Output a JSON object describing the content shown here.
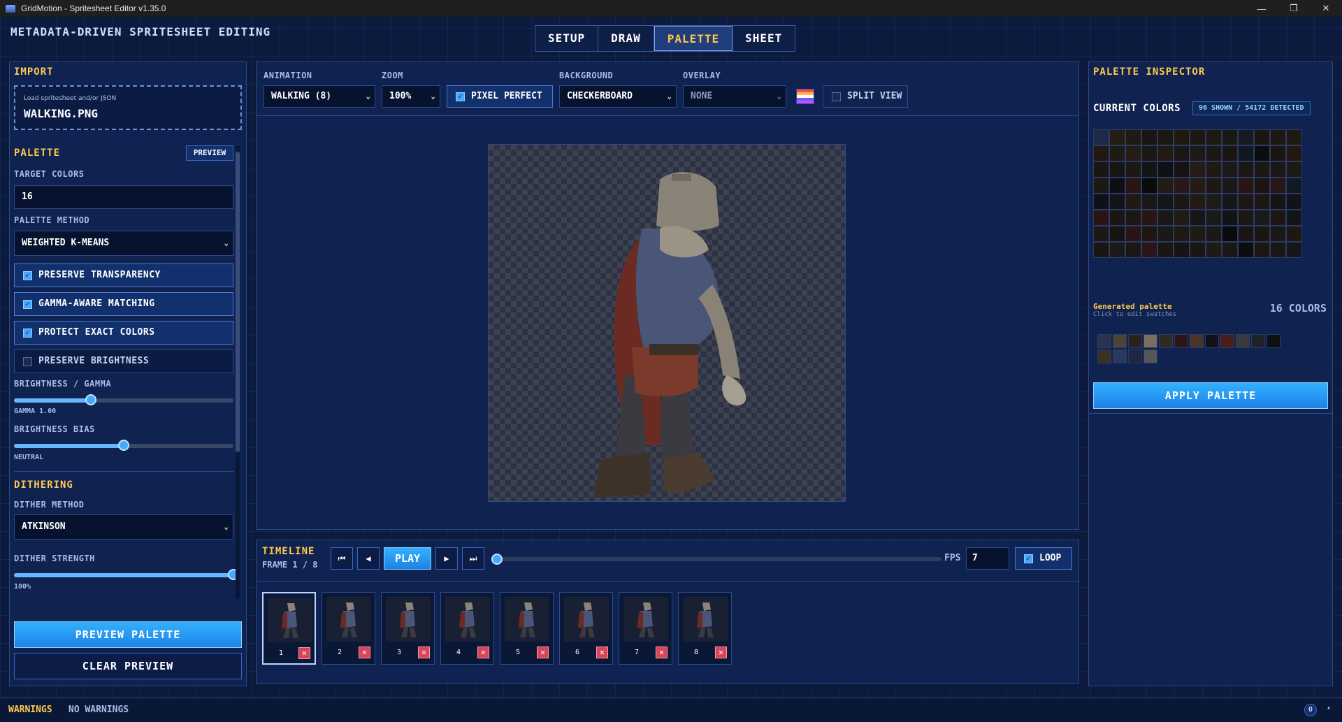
{
  "window": {
    "title": "GridMotion - Spritesheet Editor v1.35.0",
    "minimize": "—",
    "maximize": "❐",
    "close": "✕"
  },
  "app": {
    "subtitle": "METADATA-DRIVEN SPRITESHEET EDITING"
  },
  "tabs": [
    "SETUP",
    "DRAW",
    "PALETTE",
    "SHEET"
  ],
  "left": {
    "import": {
      "title": "IMPORT",
      "hint": "Load spritesheet and/or JSON",
      "file": "WALKING.PNG"
    },
    "palette": {
      "title": "PALETTE",
      "preview_btn": "PREVIEW",
      "target_colors_label": "TARGET COLORS",
      "target_colors": "16",
      "method_label": "PALETTE METHOD",
      "method": "WEIGHTED K-MEANS",
      "checks": [
        {
          "label": "PRESERVE TRANSPARENCY",
          "checked": true
        },
        {
          "label": "GAMMA-AWARE MATCHING",
          "checked": true
        },
        {
          "label": "PROTECT EXACT COLORS",
          "checked": true
        },
        {
          "label": "PRESERVE BRIGHTNESS",
          "checked": false
        }
      ],
      "gamma_label": "BRIGHTNESS / GAMMA",
      "gamma_value": "GAMMA 1.00",
      "gamma_level": 0.35,
      "bias_label": "BRIGHTNESS BIAS",
      "bias_value": "NEUTRAL",
      "bias_level": 0.5
    },
    "dithering": {
      "title": "DITHERING",
      "method_label": "DITHER METHOD",
      "method": "ATKINSON",
      "strength_label": "DITHER STRENGTH",
      "strength_value": "100%",
      "strength_level": 1.0
    },
    "preview_palette_btn": "PREVIEW PALETTE",
    "clear_preview_btn": "CLEAR PREVIEW"
  },
  "toolbar": {
    "animation_label": "ANIMATION",
    "animation": "WALKING (8)",
    "zoom_label": "ZOOM",
    "zoom": "100%",
    "pixel_perfect": "PIXEL PERFECT",
    "background_label": "BACKGROUND",
    "background": "CHECKERBOARD",
    "overlay_label": "OVERLAY",
    "overlay": "NONE",
    "split_view": "SPLIT VIEW"
  },
  "timeline": {
    "title": "TIMELINE",
    "frame_info": "FRAME 1 / 8",
    "play": "PLAY",
    "first": "⏮",
    "prev": "◀",
    "next": "▶",
    "last": "⏭",
    "fps_label": "FPS",
    "fps": "7",
    "loop": "LOOP",
    "frames": [
      "1",
      "2",
      "3",
      "4",
      "5",
      "6",
      "7",
      "8"
    ],
    "progress": 0.0
  },
  "right": {
    "title": "PALETTE INSPECTOR",
    "current_colors_label": "CURRENT COLORS",
    "badge": "96 SHOWN / 54172 DETECTED",
    "generated_label": "Generated palette",
    "generated_hint": "Click to edit swatches",
    "count": "16 COLORS",
    "apply_btn": "APPLY PALETTE",
    "current": [
      "#1d2a4a",
      "#241d14",
      "#1f1a14",
      "#1a1613",
      "#1b1812",
      "#20190f",
      "#1e1812",
      "#1d1a14",
      "#1a1814",
      "#161a22",
      "#1a1713",
      "#1c1814",
      "#1d1a16",
      "#221a12",
      "#1e1b16",
      "#241d15",
      "#1c1813",
      "#211b13",
      "#1b1714",
      "#1e1914",
      "#1d1813",
      "#1b1611",
      "#13171f",
      "#0c0d11",
      "#1a1712",
      "#201811",
      "#1a1612",
      "#191512",
      "#1d1813",
      "#141516",
      "#0e1015",
      "#161312",
      "#251d14",
      "#201a13",
      "#1c1a16",
      "#1a1815",
      "#1c1812",
      "#1b1714",
      "#1d1915",
      "#1d1912",
      "#0d0f12",
      "#2a1414",
      "#0a0b0d",
      "#221c14",
      "#2b1716",
      "#241b14",
      "#1e1812",
      "#191818",
      "#2a1515",
      "#1d1511",
      "#2a1616",
      "#111826",
      "#101114",
      "#121418",
      "#231913",
      "#1a1715",
      "#151617",
      "#1b1714",
      "#241a14",
      "#1f1b15",
      "#161719",
      "#1e1612",
      "#1c1712",
      "#141414",
      "#101318",
      "#2b1414",
      "#1c1612",
      "#1d1713",
      "#2a1515",
      "#1c1915",
      "#211b14",
      "#141617",
      "#1a1a1a",
      "#121314",
      "#1b1713",
      "#1a1a1c",
      "#1e1611",
      "#141518",
      "#1e1814",
      "#161411",
      "#2a1414",
      "#1d1612",
      "#1b1915",
      "#1f1813",
      "#1f1a14",
      "#1c1814",
      "#0a0a0b",
      "#181512",
      "#191612",
      "#1a1816",
      "#1e1813",
      "#1a1612",
      "#1c1a18",
      "#1b1713",
      "#2a1616",
      "#1c1612",
      "#171411",
      "#1b1612",
      "#1e1a14",
      "#1c1713",
      "#0c0d0f",
      "#1d1612",
      "#1c1714",
      "#15161a"
    ],
    "generated": [
      "#2a3450",
      "#4d4438",
      "#2a231c",
      "#7a6e5e",
      "#2f2a22",
      "#2a1612",
      "#4a3528",
      "#101217",
      "#4a1c1a",
      "#3a3a3c",
      "#1f222a",
      "#0e1012",
      "#3a3026",
      "#2a3a5c",
      "#1e2740",
      "#565656"
    ]
  },
  "status": {
    "warnings_label": "WARNINGS",
    "warnings_value": "NO WARNINGS",
    "badge": "0"
  },
  "colors": {
    "accent": "#ffc94d",
    "primary": "#33b1ff",
    "bg": "#0b1a3d"
  }
}
